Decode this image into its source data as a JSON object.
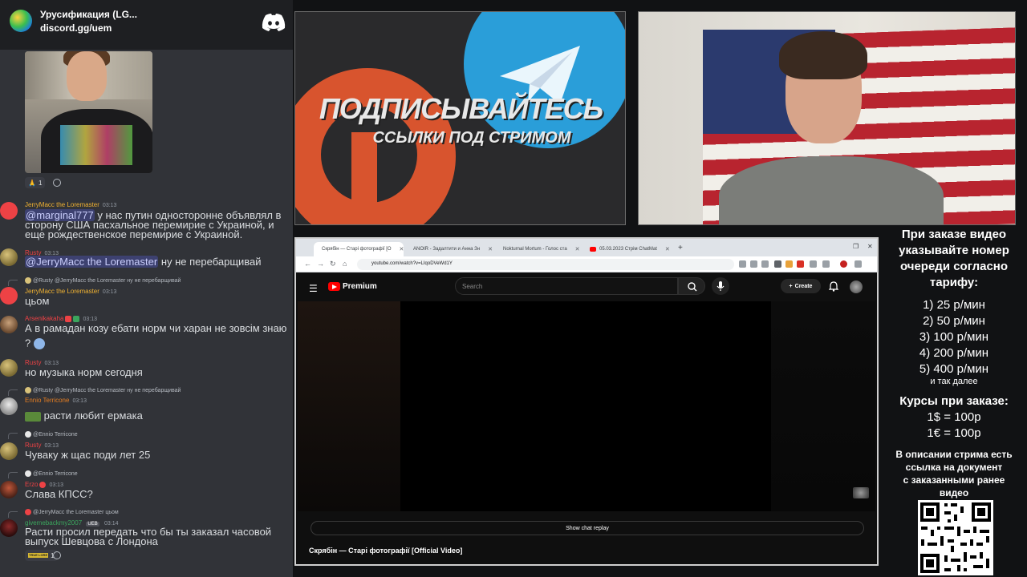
{
  "chat": {
    "server_name": "Урусификация (LG...",
    "server_link": "discord.gg/uem",
    "reaction_top": {
      "emoji": "🙏",
      "count": "1"
    },
    "messages": [
      {
        "user": "JerryMacc the Loremaster",
        "time": "03:13",
        "lines": [
          "у нас путин односторонне объявлял в",
          "сторону США пасхальное перемирие с Украиной, и",
          "еще рождественское перемирие с Украиной."
        ],
        "mention": "@marginal777",
        "user_color": "#f0b232"
      },
      {
        "user": "Rusty",
        "time": "03:13",
        "mention": "@JerryMacc the Loremaster",
        "lines": [
          "ну не перебарщивай"
        ],
        "user_color": "#ed4245"
      },
      {
        "reply": "@Rusty @JerryMacc the Loremaster ну не перебарщивай",
        "user": "JerryMacc the Loremaster",
        "time": "03:13",
        "lines": [
          "цьом"
        ],
        "user_color": "#f0b232"
      },
      {
        "user": "Arsenikakaha",
        "time": "03:13",
        "lines": [
          "А в рамадан козу ебати норм чи харан не зовсім знаю",
          "?"
        ],
        "user_color": "#ed4245"
      },
      {
        "user": "Rusty",
        "time": "03:13",
        "lines": [
          "но музыка норм сегодня"
        ],
        "user_color": "#ed4245"
      },
      {
        "reply": "@Rusty @JerryMacc the Loremaster ну не перебарщивай",
        "user": "Ennio Terricone",
        "time": "03:13",
        "lines": [
          "расти любит ермака"
        ],
        "user_color": "#e67e22"
      },
      {
        "reply": "@Ennio Terricone",
        "user": "Rusty",
        "time": "03:13",
        "lines": [
          "Чуваку ж щас поди лет 25"
        ],
        "user_color": "#ed4245"
      },
      {
        "reply": "@Ennio Terricone",
        "user": "Erzo",
        "time": "03:13",
        "lines": [
          "Слава КПСС?"
        ],
        "user_color": "#ed4245"
      },
      {
        "reply": "@JerryMacc the Loremaster цьом",
        "user": "givemebackmy2007",
        "badge": "UEB",
        "time": "03:14",
        "lines": [
          "Расти просил передать что бы ты заказал часовой",
          "выпуск Шевцова с Лондона"
        ],
        "user_color": "#3ba55d"
      }
    ],
    "reaction_bottom": {
      "emoji": "TRUE LORE",
      "count": "1"
    }
  },
  "banner": {
    "title": "ПОДПИСЫВАЙТЕСЬ",
    "subtitle": "ССЫЛКИ ПОД СТРИМОМ"
  },
  "browser": {
    "tabs": [
      "Скрябін — Старі фотографії [О",
      "ANOIR - Задалтити и Анна Зн",
      "Nokturnal Mortum - Голос ста",
      "05.03.2023 Стрім ChatMat"
    ],
    "url": "youtube.com/watch?v=LIqoDVeWd1Y",
    "yt_brand": "Premium",
    "search_placeholder": "Search",
    "create_label": "Create",
    "show_chat_replay": "Show chat replay",
    "video_title": "Скрябін — Старі фотографії [Official Video]"
  },
  "info": {
    "order_lines": [
      "При заказе видео",
      "указывайте номер",
      "очереди согласно",
      "тарифу:"
    ],
    "tariffs": [
      "1) 25 р/мин",
      "2) 50 р/мин",
      "3) 100 р/мин",
      "4) 200 р/мин",
      "5) 400 р/мин"
    ],
    "etc": "и так далее",
    "rates_title": "Курсы при заказе:",
    "rates": [
      "1$ = 100р",
      "1€ = 100р"
    ],
    "desc_lines": [
      "В описании стрима есть",
      "ссылка на документ",
      "с заказанными ранее",
      "видео"
    ]
  },
  "colors": {
    "chat_bg": "#313338",
    "header_bg": "#1e1f22",
    "mention_bg": "#3c4270",
    "yt_red": "#ff0000",
    "banner_orange": "#d8542e",
    "banner_blue": "#2a9ed9"
  }
}
